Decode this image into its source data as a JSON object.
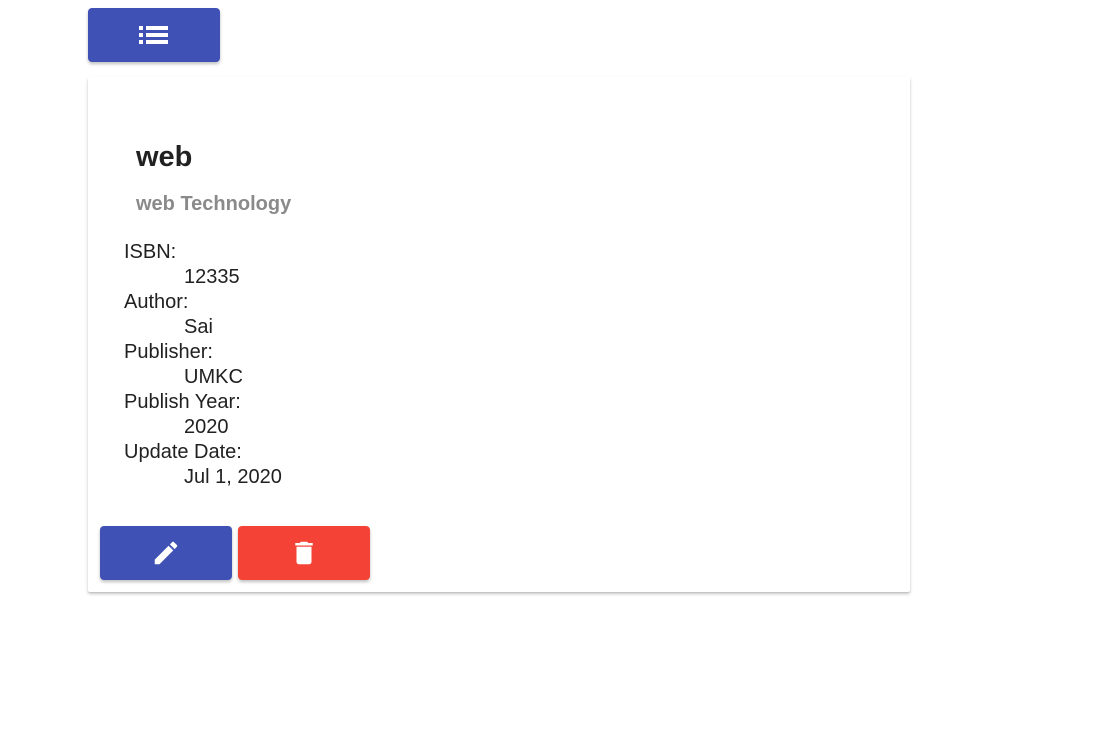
{
  "toolbar": {
    "list_icon": "format-list-bulleted-icon",
    "accent": "#3f51b5"
  },
  "book": {
    "title": "web",
    "subtitle": "web Technology",
    "fields": [
      {
        "label": "ISBN:",
        "value": "12335"
      },
      {
        "label": "Author:",
        "value": "Sai"
      },
      {
        "label": "Publisher:",
        "value": "UMKC"
      },
      {
        "label": "Publish Year:",
        "value": "2020"
      },
      {
        "label": "Update Date:",
        "value": "Jul 1, 2020"
      }
    ]
  },
  "actions": {
    "edit_icon": "pencil-icon",
    "edit_color": "#3f51b5",
    "delete_icon": "trash-icon",
    "delete_color": "#f44336"
  }
}
